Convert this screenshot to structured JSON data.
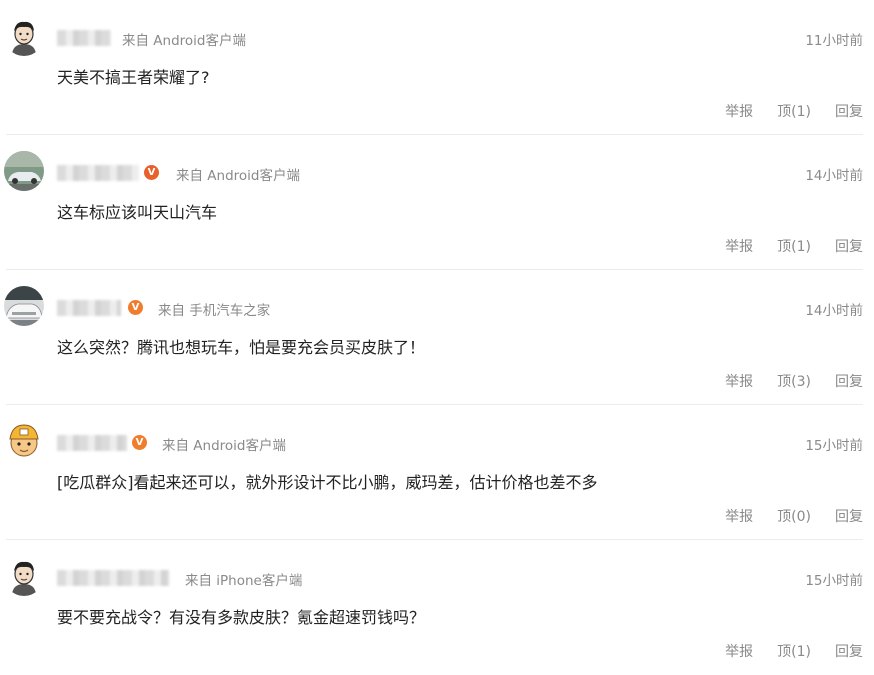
{
  "colors": {
    "v_badge": "#e7612a",
    "v_badge_alt": "#f07d2d",
    "meta": "#8a8a8a",
    "divider": "#ececec"
  },
  "comments": [
    {
      "avatar_icon": "cartoon-man-avatar-icon",
      "source": "来自 Android客户端",
      "time": "11小时前",
      "text": "天美不搞王者荣耀了?",
      "actions": {
        "report": "举报",
        "upvote": "顶(1)",
        "reply": "回复"
      }
    },
    {
      "avatar_icon": "car-photo-avatar-icon",
      "verified": "V",
      "source": "来自 Android客户端",
      "time": "14小时前",
      "text": "这车标应该叫天山汽车",
      "actions": {
        "report": "举报",
        "upvote": "顶(1)",
        "reply": "回复"
      }
    },
    {
      "avatar_icon": "white-car-avatar-icon",
      "verified": "V",
      "source": "来自 手机汽车之家",
      "time": "14小时前",
      "text": "这么突然？腾讯也想玩车，怕是要充会员买皮肤了！",
      "actions": {
        "report": "举报",
        "upvote": "顶(3)",
        "reply": "回复"
      }
    },
    {
      "avatar_icon": "cartoon-helmet-avatar-icon",
      "verified": "V",
      "source": "来自 Android客户端",
      "time": "15小时前",
      "text": "[吃瓜群众]看起来还可以，就外形设计不比小鹏，威玛差，估计价格也差不多",
      "actions": {
        "report": "举报",
        "upvote": "顶(0)",
        "reply": "回复"
      }
    },
    {
      "avatar_icon": "cartoon-man-avatar-icon",
      "source": "来自 iPhone客户端",
      "time": "15小时前",
      "text": "要不要充战令？有没有多款皮肤？氪金超速罚钱吗？",
      "actions": {
        "report": "举报",
        "upvote": "顶(1)",
        "reply": "回复"
      }
    }
  ]
}
